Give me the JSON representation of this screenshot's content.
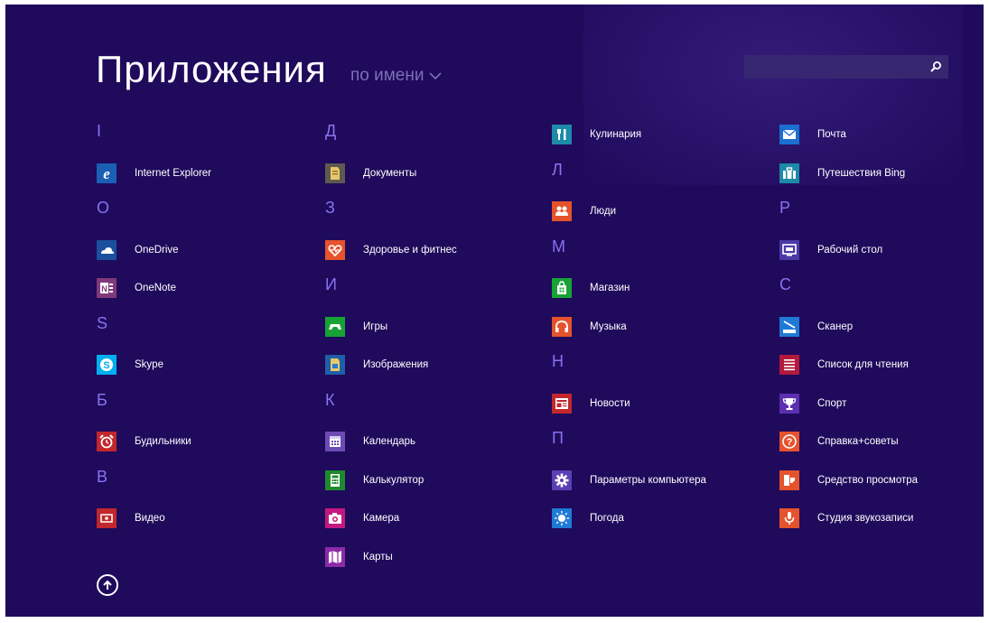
{
  "header": {
    "title": "Приложения",
    "sort_label": "по имени"
  },
  "search": {
    "placeholder": "",
    "value": ""
  },
  "columns": [
    {
      "groups": [
        {
          "letter": "I",
          "apps": [
            {
              "label": "Internet Explorer",
              "icon": "internet-explorer-icon",
              "color": "#1a5fb4"
            }
          ]
        },
        {
          "letter": "O",
          "apps": [
            {
              "label": "OneDrive",
              "icon": "onedrive-icon",
              "color": "#1c4f9c"
            },
            {
              "label": "OneNote",
              "icon": "onenote-icon",
              "color": "#80397b"
            }
          ]
        },
        {
          "letter": "S",
          "apps": [
            {
              "label": "Skype",
              "icon": "skype-icon",
              "color": "#00aff0"
            }
          ]
        },
        {
          "letter": "Б",
          "apps": [
            {
              "label": "Будильники",
              "icon": "alarm-clock-icon",
              "color": "#c1272d"
            }
          ]
        },
        {
          "letter": "В",
          "apps": [
            {
              "label": "Видео",
              "icon": "video-icon",
              "color": "#c1272d"
            }
          ]
        }
      ]
    },
    {
      "groups": [
        {
          "letter": "Д",
          "apps": [
            {
              "label": "Документы",
              "icon": "documents-folder-icon",
              "color": "#5e5a4f"
            }
          ]
        },
        {
          "letter": "З",
          "apps": [
            {
              "label": "Здоровье и фитнес",
              "icon": "health-heart-icon",
              "color": "#e5532d"
            }
          ]
        },
        {
          "letter": "И",
          "apps": [
            {
              "label": "Игры",
              "icon": "games-controller-icon",
              "color": "#17a236"
            },
            {
              "label": "Изображения",
              "icon": "pictures-folder-icon",
              "color": "#1f5fa8"
            }
          ]
        },
        {
          "letter": "К",
          "apps": [
            {
              "label": "Календарь",
              "icon": "calendar-icon",
              "color": "#6d4bb6"
            },
            {
              "label": "Калькулятор",
              "icon": "calculator-icon",
              "color": "#1e8a2d"
            },
            {
              "label": "Камера",
              "icon": "camera-icon",
              "color": "#c2187f"
            },
            {
              "label": "Карты",
              "icon": "maps-icon",
              "color": "#8c2aa8"
            }
          ]
        }
      ]
    },
    {
      "groups": [
        {
          "letter": "",
          "apps": [
            {
              "label": "Кулинария",
              "icon": "food-cutlery-icon",
              "color": "#1c8aa8"
            }
          ]
        },
        {
          "letter": "Л",
          "apps": [
            {
              "label": "Люди",
              "icon": "people-icon",
              "color": "#e5532d"
            }
          ]
        },
        {
          "letter": "М",
          "apps": [
            {
              "label": "Магазин",
              "icon": "store-bag-icon",
              "color": "#17a236"
            },
            {
              "label": "Музыка",
              "icon": "music-headphones-icon",
              "color": "#e5532d"
            }
          ]
        },
        {
          "letter": "Н",
          "apps": [
            {
              "label": "Новости",
              "icon": "news-icon",
              "color": "#c1272d"
            }
          ]
        },
        {
          "letter": "П",
          "apps": [
            {
              "label": "Параметры компьютера",
              "icon": "settings-gear-icon",
              "color": "#5b3fb3"
            },
            {
              "label": "Погода",
              "icon": "weather-sun-icon",
              "color": "#1f7ad6"
            }
          ]
        }
      ]
    },
    {
      "groups": [
        {
          "letter": "",
          "apps": [
            {
              "label": "Почта",
              "icon": "mail-envelope-icon",
              "color": "#1a6fd1"
            },
            {
              "label": "Путешествия Bing",
              "icon": "travel-suitcase-icon",
              "color": "#1c8aa8"
            }
          ]
        },
        {
          "letter": "Р",
          "apps": [
            {
              "label": "Рабочий стол",
              "icon": "desktop-icon",
              "color": "#4b3aa6"
            }
          ]
        },
        {
          "letter": "С",
          "apps": [
            {
              "label": "Сканер",
              "icon": "scanner-icon",
              "color": "#1f7ad6"
            },
            {
              "label": "Список для чтения",
              "icon": "reading-list-icon",
              "color": "#b3193a"
            },
            {
              "label": "Спорт",
              "icon": "sport-trophy-icon",
              "color": "#5b2fb0"
            },
            {
              "label": "Справка+советы",
              "icon": "help-question-icon",
              "color": "#e5532d"
            },
            {
              "label": "Средство просмотра",
              "icon": "reader-icon",
              "color": "#e5532d"
            },
            {
              "label": "Студия звукозаписи",
              "icon": "microphone-icon",
              "color": "#e5532d"
            }
          ]
        }
      ]
    }
  ]
}
